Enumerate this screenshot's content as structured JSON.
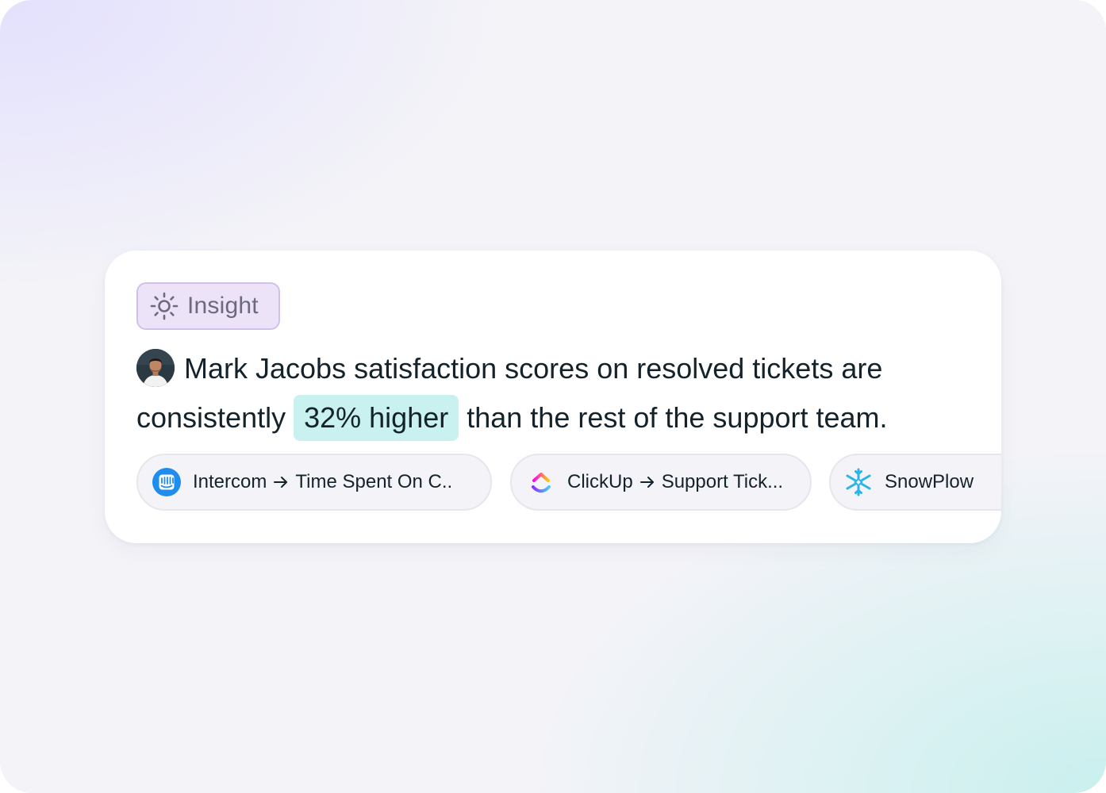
{
  "badge": {
    "label": "Insight",
    "icon": "sun-icon"
  },
  "insight": {
    "line1": "Mark Jacobs satisfaction scores on resolved tickets are",
    "line2_before": "consistently",
    "highlight": "32% higher",
    "line2_after": "than the rest of the support team."
  },
  "sources": [
    {
      "app": "Intercom",
      "target": "Time Spent On C..",
      "icon": "intercom-icon"
    },
    {
      "app": "ClickUp",
      "target": "Support Tick...",
      "icon": "clickup-icon"
    },
    {
      "app": "SnowPlow",
      "target": "",
      "icon": "snowflake-icon"
    }
  ],
  "colors": {
    "badge_bg": "#ece3f8",
    "highlight_bg": "#c8f1ef",
    "text": "#14232b",
    "intercom_blue": "#1f8ded",
    "snowflake_blue": "#29b5e8"
  }
}
